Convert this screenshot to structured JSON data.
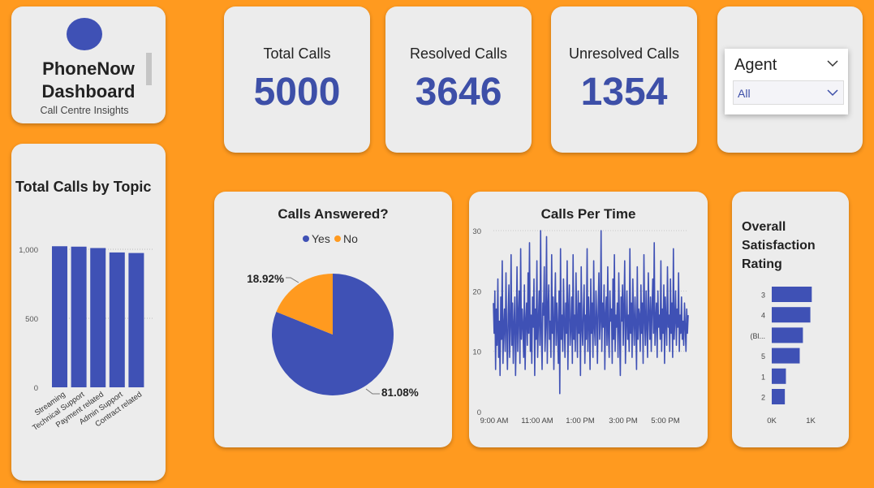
{
  "brand": {
    "line1": "PhoneNow",
    "line2": "Dashboard",
    "tagline": "Call Centre Insights"
  },
  "kpis": {
    "total": {
      "label": "Total Calls",
      "value": "5000"
    },
    "resolved": {
      "label": "Resolved Calls",
      "value": "3646"
    },
    "unresolved": {
      "label": "Unresolved Calls",
      "value": "1354"
    }
  },
  "slicer": {
    "title": "Agent",
    "selected": "All"
  },
  "colors": {
    "accent": "#3f51b5",
    "secondary": "#ff9a1f",
    "background": "#ff9a1f",
    "card": "#ececec"
  },
  "icons": {
    "logo": "logo-circle-icon",
    "dropdown": "chevron-down-icon"
  },
  "charts": {
    "topic": {
      "title": "Total Calls by Topic"
    },
    "answered": {
      "title": "Calls Answered?",
      "yes_pct_label": "81.08%",
      "no_pct_label": "18.92%"
    },
    "time": {
      "title": "Calls Per Time"
    },
    "satisfaction": {
      "title_line1": "Overall",
      "title_line2": "Satisfaction",
      "title_line3": "Rating"
    }
  },
  "chart_data": [
    {
      "type": "bar",
      "title": "Total Calls by Topic",
      "categories": [
        "Streaming",
        "Technical Support",
        "Payment related",
        "Admin Support",
        "Contract related"
      ],
      "values": [
        1022,
        1019,
        1009,
        977,
        973
      ],
      "ylim": [
        0,
        1100
      ],
      "yticks": [
        0,
        500,
        1000
      ],
      "ytick_labels": [
        "0",
        "500",
        "1,000"
      ],
      "grid": true
    },
    {
      "type": "pie",
      "title": "Calls Answered?",
      "legend": [
        "Yes",
        "No"
      ],
      "legend_position": "top",
      "values": [
        81.08,
        18.92
      ],
      "labels": [
        "81.08%",
        "18.92%"
      ]
    },
    {
      "type": "line",
      "title": "Calls Per Time",
      "ylim": [
        0,
        30
      ],
      "yticks": [
        0,
        10,
        20,
        30
      ],
      "x_range": [
        "9:00 AM",
        "6:00 PM"
      ],
      "xtick_labels": [
        "9:00 AM",
        "11:00 AM",
        "1:00 PM",
        "3:00 PM",
        "5:00 PM"
      ],
      "values": [
        18,
        13,
        20,
        7,
        17,
        11,
        22,
        9,
        15,
        6,
        19,
        12,
        25,
        8,
        14,
        17,
        10,
        23,
        13,
        7,
        16,
        21,
        9,
        14,
        26,
        11,
        18,
        8,
        15,
        19,
        6,
        13,
        24,
        10,
        16,
        20,
        8,
        27,
        12,
        17,
        14,
        9,
        21,
        7,
        15,
        18,
        11,
        23,
        13,
        28,
        10,
        16,
        8,
        19,
        14,
        22,
        6,
        17,
        12,
        25,
        9,
        15,
        20,
        11,
        30,
        13,
        7,
        18,
        16,
        24,
        10,
        14,
        29,
        8,
        17,
        21,
        12,
        15,
        9,
        26,
        13,
        19,
        7,
        16,
        23,
        11,
        18,
        14,
        8,
        20,
        3,
        27,
        12,
        16,
        10,
        22,
        15,
        9,
        18,
        13,
        25,
        7,
        17,
        21,
        11,
        14,
        19,
        8,
        26,
        12,
        16,
        10,
        23,
        15,
        9,
        20,
        13,
        18,
        6,
        24,
        14,
        11,
        17,
        21,
        8,
        16,
        12,
        27,
        10,
        19,
        15,
        7,
        22,
        13,
        18,
        9,
        25,
        14,
        11,
        20,
        16,
        8,
        17,
        23,
        12,
        15,
        30,
        10,
        18,
        14,
        21,
        7,
        16,
        19,
        11,
        24,
        13,
        9,
        20,
        15,
        17,
        8,
        22,
        12,
        26,
        10,
        16,
        14,
        18,
        9,
        23,
        13,
        6,
        19,
        15,
        21,
        11,
        17,
        25,
        8,
        14,
        20,
        12,
        16,
        10,
        27,
        13,
        18,
        9,
        22,
        15,
        11,
        19,
        14,
        7,
        24,
        12,
        17,
        16,
        10,
        21,
        13,
        18,
        8,
        26,
        15,
        11,
        20,
        14,
        9,
        23,
        16,
        12,
        19,
        10,
        17,
        22,
        13,
        28,
        11,
        15,
        18,
        9,
        20,
        14,
        16,
        12,
        25,
        10,
        17,
        13,
        21,
        8,
        19,
        15,
        11,
        24,
        14,
        16,
        10,
        22,
        13,
        18,
        9,
        27,
        12,
        15,
        20,
        11,
        17,
        14,
        23,
        10,
        16,
        13,
        19,
        12,
        15,
        11,
        18,
        14,
        10,
        17,
        13,
        16
      ]
    },
    {
      "type": "bar",
      "orientation": "horizontal",
      "title": "Overall Satisfaction Rating",
      "categories": [
        "3",
        "4",
        "(Bl...",
        "5",
        "1",
        "2"
      ],
      "values": [
        1130,
        1090,
        880,
        790,
        400,
        370
      ],
      "xlim": [
        0,
        1100
      ],
      "xtick_labels": [
        "0K",
        "1K"
      ]
    }
  ]
}
